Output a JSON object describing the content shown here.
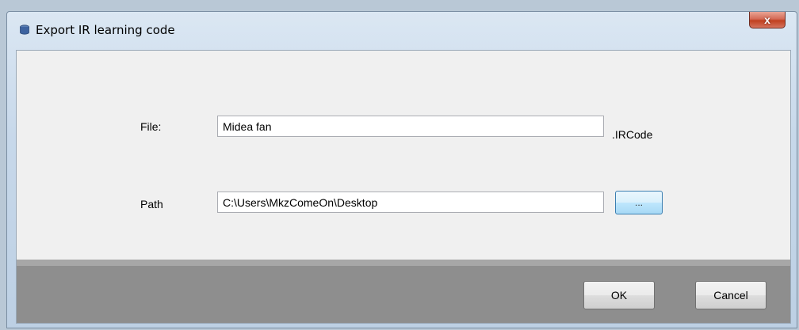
{
  "window": {
    "title": "Export IR learning code",
    "close_label": "x"
  },
  "form": {
    "file_label": "File:",
    "file_value": "Midea fan",
    "file_extension": ".IRCode",
    "path_label": "Path",
    "path_value": "C:\\Users\\MkzComeOn\\Desktop",
    "browse_label": "..."
  },
  "footer": {
    "ok_label": "OK",
    "cancel_label": "Cancel"
  },
  "colors": {
    "close_button": "#c8462b",
    "footer_bar": "#8e8e8e",
    "browse_button_border": "#3c7fb1"
  },
  "icons": {
    "title_icon": "app-icon"
  }
}
